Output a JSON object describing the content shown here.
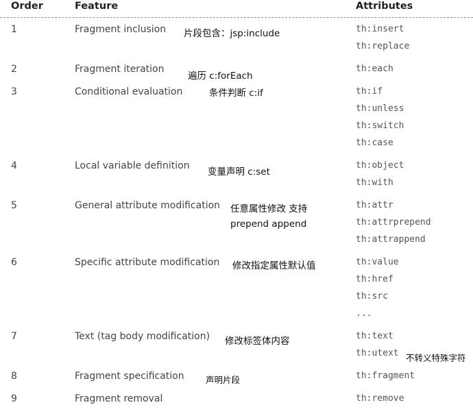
{
  "headers": {
    "order": "Order",
    "feature": "Feature",
    "attributes": "Attributes"
  },
  "rows": [
    {
      "order": "1",
      "feature": "Fragment inclusion",
      "note": "片段包含：jsp:include",
      "attributes": [
        "th:insert",
        "th:replace"
      ]
    },
    {
      "order": "2",
      "feature": "Fragment iteration",
      "note": "遍历 c:forEach",
      "attributes": [
        "th:each"
      ]
    },
    {
      "order": "3",
      "feature": "Conditional evaluation",
      "note": "条件判断 c:if",
      "attributes": [
        "th:if",
        "th:unless",
        "th:switch",
        "th:case"
      ]
    },
    {
      "order": "4",
      "feature": "Local variable definition",
      "note": "变量声明 c:set",
      "attributes": [
        "th:object",
        "th:with"
      ]
    },
    {
      "order": "5",
      "feature": "General attribute modification",
      "note": "任意属性修改 支持",
      "note2": "prepend append",
      "attributes": [
        "th:attr",
        "th:attrprepend",
        "th:attrappend"
      ]
    },
    {
      "order": "6",
      "feature": "Specific attribute modification",
      "note": "修改指定属性默认值",
      "attributes": [
        "th:value",
        "th:href",
        "th:src",
        "..."
      ]
    },
    {
      "order": "7",
      "feature": "Text (tag body modification)",
      "note": "修改标签体内容",
      "attributes": [
        "th:text",
        "th:utext"
      ],
      "attr_note": "不转义特殊字符"
    },
    {
      "order": "8",
      "feature": "Fragment specification",
      "note": "声明片段",
      "attributes": [
        "th:fragment"
      ]
    },
    {
      "order": "9",
      "feature": "Fragment removal",
      "note": "",
      "attributes": [
        "th:remove"
      ]
    }
  ]
}
